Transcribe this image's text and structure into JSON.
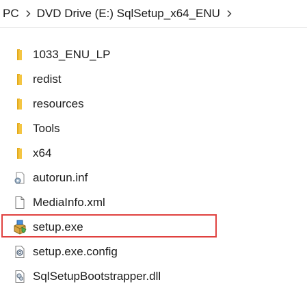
{
  "breadcrumb": {
    "items": [
      "PC",
      "DVD Drive (E:) SqlSetup_x64_ENU"
    ]
  },
  "files": [
    {
      "name": "1033_ENU_LP",
      "icon": "folder-icon"
    },
    {
      "name": "redist",
      "icon": "folder-icon"
    },
    {
      "name": "resources",
      "icon": "folder-icon"
    },
    {
      "name": "Tools",
      "icon": "folder-icon"
    },
    {
      "name": "x64",
      "icon": "folder-icon"
    },
    {
      "name": "autorun.inf",
      "icon": "settings-file-icon"
    },
    {
      "name": "MediaInfo.xml",
      "icon": "document-icon"
    },
    {
      "name": "setup.exe",
      "icon": "installer-icon"
    },
    {
      "name": "setup.exe.config",
      "icon": "config-file-icon"
    },
    {
      "name": "SqlSetupBootstrapper.dll",
      "icon": "dll-file-icon"
    }
  ],
  "highlight": {
    "target": "setup.exe",
    "color": "#e0413f"
  },
  "colors": {
    "folder": "#f4c542",
    "folder_dark": "#e3a91b"
  }
}
